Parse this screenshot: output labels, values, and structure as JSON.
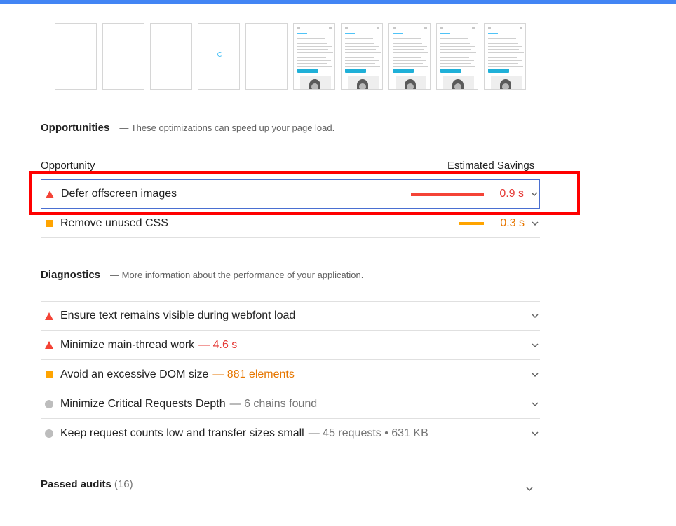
{
  "colors": {
    "topbar": "#4285f4",
    "fail": "#f44336",
    "average": "#ffa400",
    "info": "#bdbdbd",
    "highlight_box": "#ff0000"
  },
  "opportunities": {
    "title": "Opportunities",
    "description": "— These optimizations can speed up your page load.",
    "col_opportunity": "Opportunity",
    "col_savings": "Estimated Savings",
    "items": [
      {
        "icon": "fail-triangle-icon",
        "title": "Defer offscreen images",
        "savings": "0.9 s",
        "bar_fraction": 1.0
      },
      {
        "icon": "average-square-icon",
        "title": "Remove unused CSS",
        "savings": "0.3 s",
        "bar_fraction": 0.33
      }
    ]
  },
  "diagnostics": {
    "title": "Diagnostics",
    "description": "— More information about the performance of your application.",
    "items": [
      {
        "icon": "fail-triangle-icon",
        "title": "Ensure text remains visible during webfont load",
        "extra": ""
      },
      {
        "icon": "fail-triangle-icon",
        "title": "Minimize main-thread work",
        "extra": "— 4.6 s"
      },
      {
        "icon": "average-square-icon",
        "title": "Avoid an excessive DOM size",
        "extra": "— 881 elements"
      },
      {
        "icon": "info-circle-icon",
        "title": "Minimize Critical Requests Depth",
        "extra": "— 6 chains found"
      },
      {
        "icon": "info-circle-icon",
        "title": "Keep request counts low and transfer sizes small",
        "extra": "— 45 requests • 631 KB"
      }
    ]
  },
  "passed": {
    "label": "Passed audits",
    "count": "(16)"
  }
}
